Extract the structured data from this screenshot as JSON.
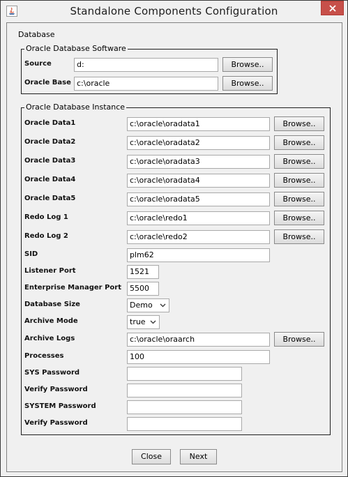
{
  "window": {
    "title": "Standalone Components Configuration"
  },
  "section_label": "Database",
  "software": {
    "legend": "Oracle Database Software",
    "rows": [
      {
        "label": "Source",
        "value": "d:",
        "button": "Browse.."
      },
      {
        "label": "Oracle Base",
        "value": "c:\\oracle",
        "button": "Browse.."
      }
    ]
  },
  "instance": {
    "legend": "Oracle Database Instance",
    "browse_rows": [
      {
        "label": "Oracle Data1",
        "value": "c:\\oracle\\oradata1",
        "button": "Browse.."
      },
      {
        "label": "Oracle Data2",
        "value": "c:\\oracle\\oradata2",
        "button": "Browse.."
      },
      {
        "label": "Oracle Data3",
        "value": "c:\\oracle\\oradata3",
        "button": "Browse.."
      },
      {
        "label": "Oracle Data4",
        "value": "c:\\oracle\\oradata4",
        "button": "Browse.."
      },
      {
        "label": "Oracle Data5",
        "value": "c:\\oracle\\oradata5",
        "button": "Browse.."
      },
      {
        "label": "Redo Log 1",
        "value": "c:\\oracle\\redo1",
        "button": "Browse.."
      },
      {
        "label": "Redo Log 2",
        "value": "c:\\oracle\\redo2",
        "button": "Browse.."
      }
    ],
    "sid": {
      "label": "SID",
      "value": "plm62"
    },
    "listener_port": {
      "label": "Listener Port",
      "value": "1521"
    },
    "em_port": {
      "label": "Enterprise Manager Port",
      "value": "5500"
    },
    "db_size": {
      "label": "Database Size",
      "value": "Demo"
    },
    "archive_mode": {
      "label": "Archive Mode",
      "value": "true"
    },
    "archive_logs": {
      "label": "Archive Logs",
      "value": "c:\\oracle\\oraarch",
      "button": "Browse.."
    },
    "processes": {
      "label": "Processes",
      "value": "100"
    },
    "sys_password": {
      "label": "SYS Password",
      "value": ""
    },
    "sys_verify": {
      "label": "Verify Password",
      "value": ""
    },
    "system_password": {
      "label": "SYSTEM Password",
      "value": ""
    },
    "system_verify": {
      "label": "Verify Password",
      "value": ""
    }
  },
  "footer": {
    "close_label": "Close",
    "next_label": "Next"
  }
}
